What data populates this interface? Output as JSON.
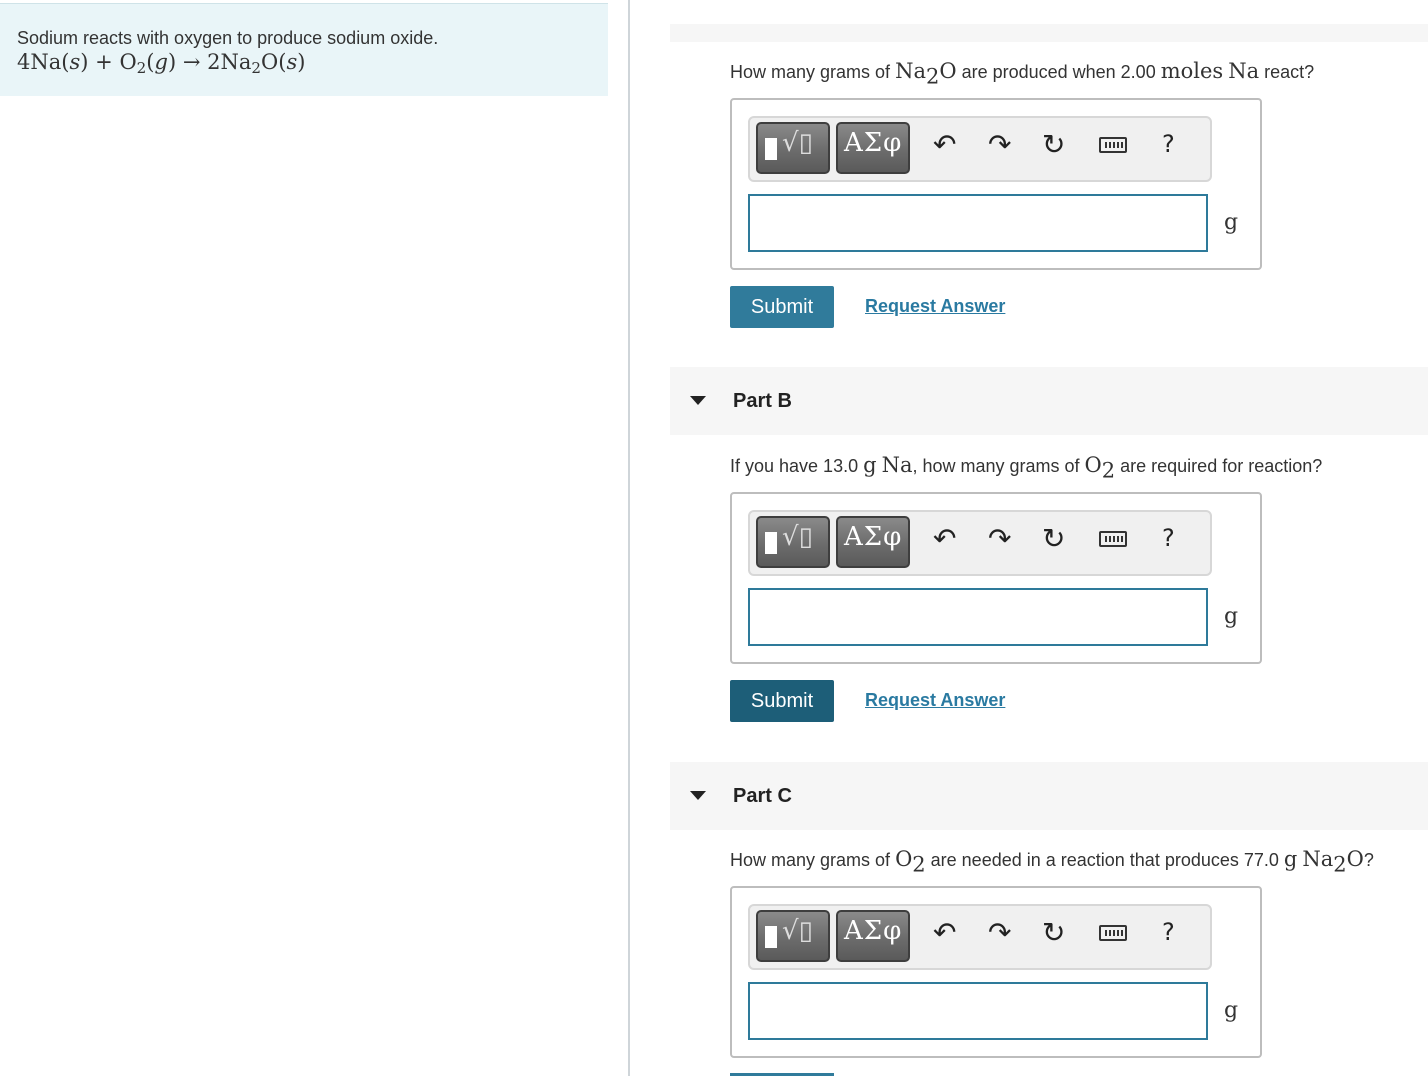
{
  "intro": {
    "text": "Sodium reacts with oxygen to produce sodium oxide.",
    "equation": {
      "c1": "4",
      "na": "Na",
      "s1": "s",
      "plus": "+",
      "o": "O",
      "sub2": "2",
      "g": "g",
      "arrow": "→",
      "c2": "2",
      "na2": "Na",
      "sub2b": "2",
      "o2": "O",
      "s2": "s"
    }
  },
  "toolbar": {
    "templates_icon": "template-radical-icon",
    "greek_label": "ΑΣφ",
    "undo_icon": "undo-icon",
    "redo_icon": "redo-icon",
    "reset_icon": "reset-icon",
    "keyboard_icon": "keyboard-icon",
    "help_label": "?"
  },
  "partA": {
    "q_pre": "How many grams of ",
    "q_chem_na": "Na",
    "q_chem_sub": "2",
    "q_chem_o": "O",
    "q_mid": " are produced when 2.00 ",
    "q_moles": "moles",
    "q_na": "Na",
    "q_post": " react?",
    "unit": "g",
    "submit": "Submit",
    "request": "Request Answer"
  },
  "partB": {
    "title": "Part B",
    "q_pre": "If you have 13.0 ",
    "q_g": "g",
    "q_na": "Na",
    "q_mid": ", how many grams of ",
    "q_o": "O",
    "q_sub": "2",
    "q_post": " are required for reaction?",
    "unit": "g",
    "submit": "Submit",
    "request": "Request Answer"
  },
  "partC": {
    "title": "Part C",
    "q_pre": "How many grams of ",
    "q_o": "O",
    "q_sub": "2",
    "q_mid": " are needed in a reaction that produces 77.0 ",
    "q_g": "g",
    "q_na": "Na",
    "q_sub2": "2",
    "q_o2": "O",
    "q_post": "?",
    "unit": "g"
  },
  "colors": {
    "intro_bg": "#e9f5f8",
    "submit_bg": "#307b9b",
    "submit_bg_active": "#1d5e78",
    "link": "#2a7aa1",
    "input_border": "#2e7a9a"
  }
}
